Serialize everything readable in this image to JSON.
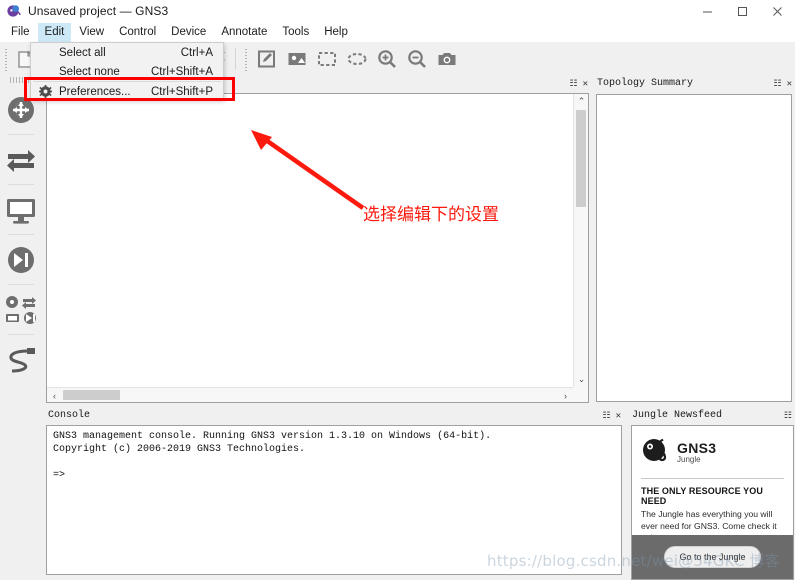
{
  "window": {
    "title": "Unsaved project — GNS3",
    "app_icon": "gns3-chameleon-icon",
    "controls": {
      "minimize": "—",
      "maximize": "▢",
      "close": "✕"
    }
  },
  "menubar": {
    "items": [
      {
        "label": "File",
        "active": false
      },
      {
        "label": "Edit",
        "active": true
      },
      {
        "label": "View",
        "active": false
      },
      {
        "label": "Control",
        "active": false
      },
      {
        "label": "Device",
        "active": false
      },
      {
        "label": "Annotate",
        "active": false
      },
      {
        "label": "Tools",
        "active": false
      },
      {
        "label": "Help",
        "active": false
      }
    ]
  },
  "edit_menu": {
    "open": true,
    "items": [
      {
        "label": "Select all",
        "accel": "Ctrl+A",
        "icon": ""
      },
      {
        "label": "Select none",
        "accel": "Ctrl+Shift+A",
        "icon": ""
      },
      {
        "label": "Preferences...",
        "accel": "Ctrl+Shift+P",
        "icon": "gear-icon",
        "highlighted": true
      }
    ]
  },
  "toolbar": {
    "items": [
      {
        "name": "new-project-button",
        "icon": "new-project-icon"
      },
      {
        "name": "open-project-button",
        "icon": "folder-open-icon"
      },
      {
        "name": "save-project-button",
        "icon": "save-icon"
      },
      {
        "name": "start-all-button",
        "icon": "play-icon",
        "color": "#8BC46A"
      },
      {
        "name": "suspend-all-button",
        "icon": "pause-icon",
        "color": "#F2E34A"
      },
      {
        "name": "stop-all-button",
        "icon": "stop-icon",
        "color": "#F8736E"
      },
      {
        "name": "reload-all-button",
        "icon": "reload-icon",
        "color": "#7a7a7a"
      },
      {
        "name": "add-note-button",
        "icon": "note-edit-icon"
      },
      {
        "name": "insert-image-button",
        "icon": "image-icon"
      },
      {
        "name": "draw-rectangle-button",
        "icon": "rectangle-icon"
      },
      {
        "name": "draw-ellipse-button",
        "icon": "ellipse-icon"
      },
      {
        "name": "zoom-in-button",
        "icon": "zoom-in-icon"
      },
      {
        "name": "zoom-out-button",
        "icon": "zoom-out-icon"
      },
      {
        "name": "screenshot-button",
        "icon": "camera-icon"
      }
    ]
  },
  "device_bar": {
    "items": [
      {
        "name": "routers-button",
        "icon": "router-icon"
      },
      {
        "name": "switches-button",
        "icon": "switch-icon"
      },
      {
        "name": "end-devices-button",
        "icon": "monitor-icon"
      },
      {
        "name": "security-devices-button",
        "icon": "play-pause-icon"
      },
      {
        "name": "all-devices-button",
        "icon": "all-devices-icon"
      },
      {
        "name": "add-link-button",
        "icon": "cable-link-icon"
      }
    ]
  },
  "panels": {
    "topology_summary": {
      "title": "Topology Summary",
      "float_icon": "float-icon",
      "close_icon": "close-icon"
    },
    "canvas": {
      "float_icon": "float-icon",
      "close_icon": "close-icon"
    },
    "console": {
      "title": "Console",
      "float_icon": "float-icon",
      "close_icon": "close-icon",
      "text": "GNS3 management console. Running GNS3 version 1.3.10 on Windows (64-bit).\nCopyright (c) 2006-2019 GNS3 Technologies.\n\n=>"
    },
    "newsfeed": {
      "title": "Jungle Newsfeed",
      "float_icon": "float-icon",
      "close_icon": "close-icon",
      "brand_main": "GNS3",
      "brand_sub": "Jungle",
      "headline": "THE ONLY RESOURCE YOU NEED",
      "description": "The Jungle has everything you will ever need for GNS3. Come check it out now.",
      "cta_label": "Go to the Jungle"
    }
  },
  "scrollbars": {
    "vertical": {
      "up_arrow": "⌃",
      "down_arrow": "⌄"
    },
    "horizontal": {
      "left_arrow": "‹",
      "right_arrow": "›"
    }
  },
  "annotations": {
    "callout_text": "选择编辑下的设置",
    "highlight_color": "#fb0000",
    "arrow_color": "#fb1a0d"
  },
  "watermark": {
    "text": "https://blog.csdn.net/wei@54GKC 博客"
  }
}
